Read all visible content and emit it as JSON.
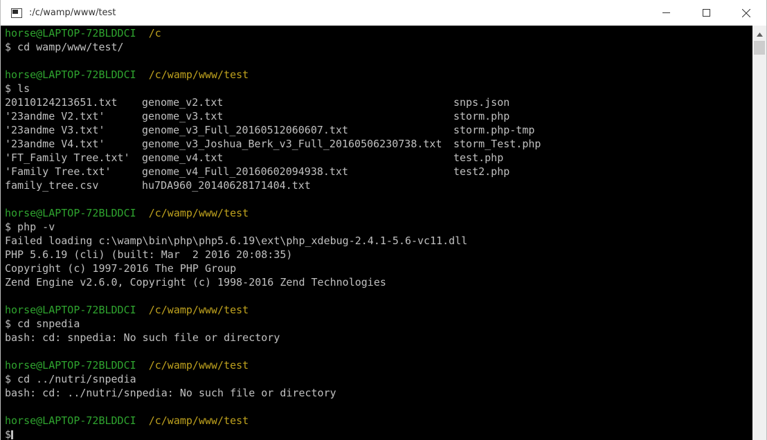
{
  "window": {
    "title": ":/c/wamp/www/test"
  },
  "terminal": {
    "user_host": "horse@LAPTOP-72BLDDCI",
    "lines": [
      {
        "type": "prompt",
        "path": "/c"
      },
      {
        "type": "cmd",
        "text": "$ cd wamp/www/test/"
      },
      {
        "type": "blank"
      },
      {
        "type": "prompt",
        "path": "/c/wamp/www/test"
      },
      {
        "type": "cmd",
        "text": "$ ls"
      },
      {
        "type": "ls",
        "cols": [
          "20110124213651.txt",
          "genome_v2.txt",
          "snps.json"
        ]
      },
      {
        "type": "ls",
        "cols": [
          "'23andme V2.txt'",
          "genome_v3.txt",
          "storm.php"
        ]
      },
      {
        "type": "ls",
        "cols": [
          "'23andme V3.txt'",
          "genome_v3_Full_20160512060607.txt",
          "storm.php-tmp"
        ]
      },
      {
        "type": "ls",
        "cols": [
          "'23andme V4.txt'",
          "genome_v3_Joshua_Berk_v3_Full_20160506230738.txt",
          "storm_Test.php"
        ]
      },
      {
        "type": "ls",
        "cols": [
          "'FT_Family Tree.txt'",
          "genome_v4.txt",
          "test.php"
        ]
      },
      {
        "type": "ls",
        "cols": [
          "'Family Tree.txt'",
          "genome_v4_Full_20160602094938.txt",
          "test2.php"
        ]
      },
      {
        "type": "ls",
        "cols": [
          "family_tree.csv",
          "hu7DA960_20140628171404.txt",
          ""
        ]
      },
      {
        "type": "blank"
      },
      {
        "type": "prompt",
        "path": "/c/wamp/www/test"
      },
      {
        "type": "cmd",
        "text": "$ php -v"
      },
      {
        "type": "out",
        "text": "Failed loading c:\\wamp\\bin\\php\\php5.6.19\\ext\\php_xdebug-2.4.1-5.6-vc11.dll"
      },
      {
        "type": "out",
        "text": "PHP 5.6.19 (cli) (built: Mar  2 2016 20:08:35)"
      },
      {
        "type": "out",
        "text": "Copyright (c) 1997-2016 The PHP Group"
      },
      {
        "type": "out",
        "text": "Zend Engine v2.6.0, Copyright (c) 1998-2016 Zend Technologies"
      },
      {
        "type": "blank"
      },
      {
        "type": "prompt",
        "path": "/c/wamp/www/test"
      },
      {
        "type": "cmd",
        "text": "$ cd snpedia"
      },
      {
        "type": "out",
        "text": "bash: cd: snpedia: No such file or directory"
      },
      {
        "type": "blank"
      },
      {
        "type": "prompt",
        "path": "/c/wamp/www/test"
      },
      {
        "type": "cmd",
        "text": "$ cd ../nutri/snpedia"
      },
      {
        "type": "out",
        "text": "bash: cd: ../nutri/snpedia: No such file or directory"
      },
      {
        "type": "blank"
      },
      {
        "type": "prompt",
        "path": "/c/wamp/www/test"
      },
      {
        "type": "input",
        "text": "$"
      }
    ]
  },
  "colors": {
    "background": "#000000",
    "text": "#c0c0c0",
    "prompt_user": "#2fa52f",
    "prompt_path": "#bfa21e"
  },
  "icons": {
    "app": "terminal-app-icon",
    "minimize": "minimize-icon",
    "maximize": "maximize-icon",
    "close": "close-icon",
    "scroll_up": "scroll-up-arrow-icon"
  }
}
